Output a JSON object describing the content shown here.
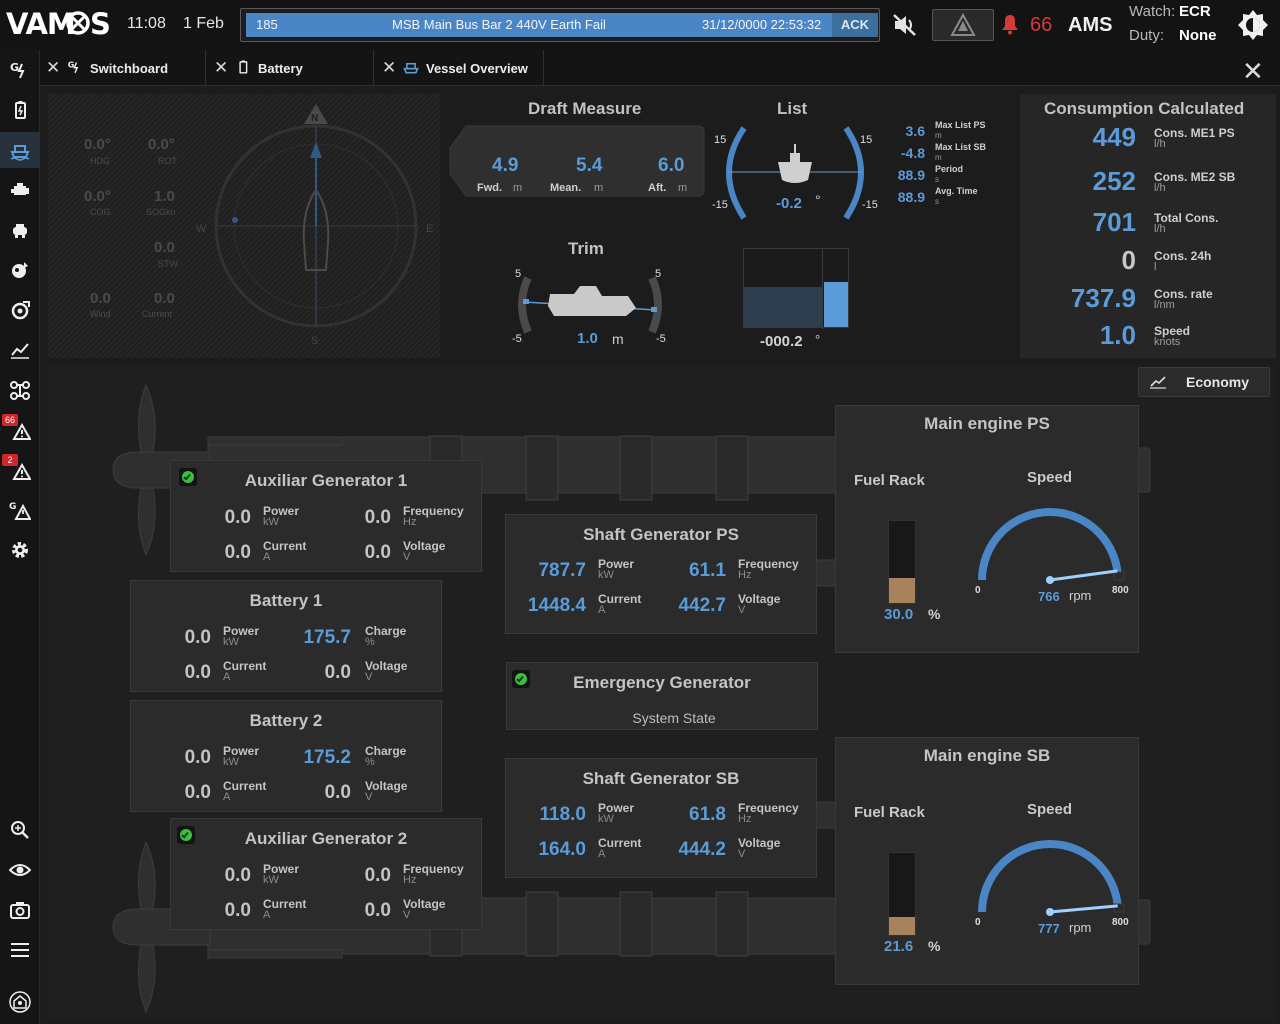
{
  "header": {
    "logo": "VAMOS",
    "time": "11:08",
    "date": "1 Feb",
    "alarm": {
      "id": "185",
      "message": "MSB Main Bus Bar 2 440V Earth Fail",
      "timestamp": "31/12/0000 22:53:32",
      "ack_label": "ACK"
    },
    "alarm_count": "66",
    "system": "AMS",
    "watch_label": "Watch:",
    "watch_value": "ECR",
    "duty_label": "Duty:",
    "duty_value": "None"
  },
  "sidebar": {
    "items": [
      {
        "icon": "generator-icon"
      },
      {
        "icon": "battery-icon"
      },
      {
        "icon": "vessel-icon",
        "active": true
      },
      {
        "icon": "engine-icon"
      },
      {
        "icon": "pump-icon"
      },
      {
        "icon": "fuel-icon"
      },
      {
        "icon": "thruster-icon"
      },
      {
        "icon": "trend-icon"
      },
      {
        "icon": "network-icon"
      },
      {
        "icon": "alarm-list-icon",
        "badge": "66"
      },
      {
        "icon": "alarm-warning-icon",
        "badge": "2"
      },
      {
        "icon": "generator-alarm-icon"
      },
      {
        "icon": "settings-icon"
      }
    ],
    "bottom": [
      {
        "icon": "zoom-icon"
      },
      {
        "icon": "eye-icon"
      },
      {
        "icon": "camera-icon"
      },
      {
        "icon": "menu-icon"
      },
      {
        "icon": "user-icon"
      }
    ]
  },
  "tabs": [
    {
      "label": "Switchboard",
      "icon": "generator-icon"
    },
    {
      "label": "Battery",
      "icon": "battery-icon"
    },
    {
      "label": "Vessel Overview",
      "icon": "vessel-icon",
      "active": true
    }
  ],
  "navigation": {
    "hdg": {
      "value": "0.0°",
      "label": "HDG"
    },
    "rot": {
      "value": "0.0°",
      "label": "ROT"
    },
    "cog": {
      "value": "0.0°",
      "label": "COG"
    },
    "sog": {
      "value": "1.0",
      "label": "SOGkn"
    },
    "stw": {
      "value": "0.0",
      "label": "STW"
    },
    "wind": {
      "value": "0.0",
      "label": "Wind"
    },
    "current": {
      "value": "0.0",
      "label": "Current"
    },
    "compass": {
      "n": "N",
      "s": "S",
      "e": "E",
      "w": "W"
    }
  },
  "draft": {
    "title": "Draft Measure",
    "fwd": {
      "value": "4.9",
      "label": "Fwd.",
      "unit": "m"
    },
    "mean": {
      "value": "5.4",
      "label": "Mean.",
      "unit": "m"
    },
    "aft": {
      "value": "6.0",
      "label": "Aft.",
      "unit": "m"
    }
  },
  "list": {
    "title": "List",
    "value": "-0.2",
    "unit": "°",
    "scale_max": "15",
    "scale_min": "-15",
    "stats": [
      {
        "value": "3.6",
        "label": "Max List PS",
        "unit": "m"
      },
      {
        "value": "-4.8",
        "label": "Max List SB",
        "unit": "m"
      },
      {
        "value": "88.9",
        "label": "Period",
        "unit": "s"
      },
      {
        "value": "88.9",
        "label": "Avg.  Time",
        "unit": "s"
      }
    ]
  },
  "trim": {
    "title": "Trim",
    "value": "1.0",
    "unit": "m",
    "scale_max": "5",
    "scale_min": "-5"
  },
  "tank": {
    "value": "-000.2",
    "unit": "°",
    "level": 0.58
  },
  "consumption": {
    "title": "Consumption Calculated",
    "rows": [
      {
        "value": "449",
        "name": "Cons. ME1 PS",
        "unit": "l/h"
      },
      {
        "value": "252",
        "name": "Cons. ME2 SB",
        "unit": "l/h"
      },
      {
        "value": "701",
        "name": "Total Cons.",
        "unit": "l/h"
      },
      {
        "value": "0",
        "name": "Cons. 24h",
        "unit": "l"
      },
      {
        "value": "737.9",
        "name": "Cons. rate",
        "unit": "l/nm"
      },
      {
        "value": "1.0",
        "name": "Speed",
        "unit": "knots"
      }
    ]
  },
  "economy_label": "Economy",
  "aux_gen_1": {
    "title": "Auxiliar Generator 1",
    "power": "0.0",
    "frequency": "0.0",
    "current": "0.0",
    "voltage": "0.0"
  },
  "aux_gen_2": {
    "title": "Auxiliar Generator 2",
    "power": "0.0",
    "frequency": "0.0",
    "current": "0.0",
    "voltage": "0.0"
  },
  "battery_1": {
    "title": "Battery 1",
    "power": "0.0",
    "charge": "175.7",
    "current": "0.0",
    "voltage": "0.0"
  },
  "battery_2": {
    "title": "Battery 2",
    "power": "0.0",
    "charge": "175.2",
    "current": "0.0",
    "voltage": "0.0"
  },
  "shaft_gen_ps": {
    "title": "Shaft Generator PS",
    "power": "787.7",
    "frequency": "61.1",
    "current": "1448.4",
    "voltage": "442.7"
  },
  "shaft_gen_sb": {
    "title": "Shaft Generator SB",
    "power": "118.0",
    "frequency": "61.8",
    "current": "164.0",
    "voltage": "444.2"
  },
  "emergency_gen": {
    "title": "Emergency Generator",
    "state": "System State"
  },
  "labels": {
    "power": "Power",
    "kw": "kW",
    "frequency": "Frequency",
    "hz": "Hz",
    "current": "Current",
    "a": "A",
    "voltage": "Voltage",
    "v": "V",
    "charge": "Charge",
    "pct": "%",
    "fuel_rack": "Fuel Rack",
    "speed": "Speed",
    "rpm": "rpm",
    "gauge_min": "0",
    "gauge_max": "800"
  },
  "main_engine_ps": {
    "title": "Main engine PS",
    "fuel_rack": "30.0",
    "fuel_rack_level": 0.3,
    "speed": "766",
    "speed_fraction": 0.9575
  },
  "main_engine_sb": {
    "title": "Main engine SB",
    "fuel_rack": "21.6",
    "fuel_rack_level": 0.216,
    "speed": "777",
    "speed_fraction": 0.97125
  },
  "colors": {
    "accent": "#5a9bd8",
    "alarm": "#d33a3a",
    "ok": "#3fbf3f",
    "fuel": "#a8825a"
  }
}
